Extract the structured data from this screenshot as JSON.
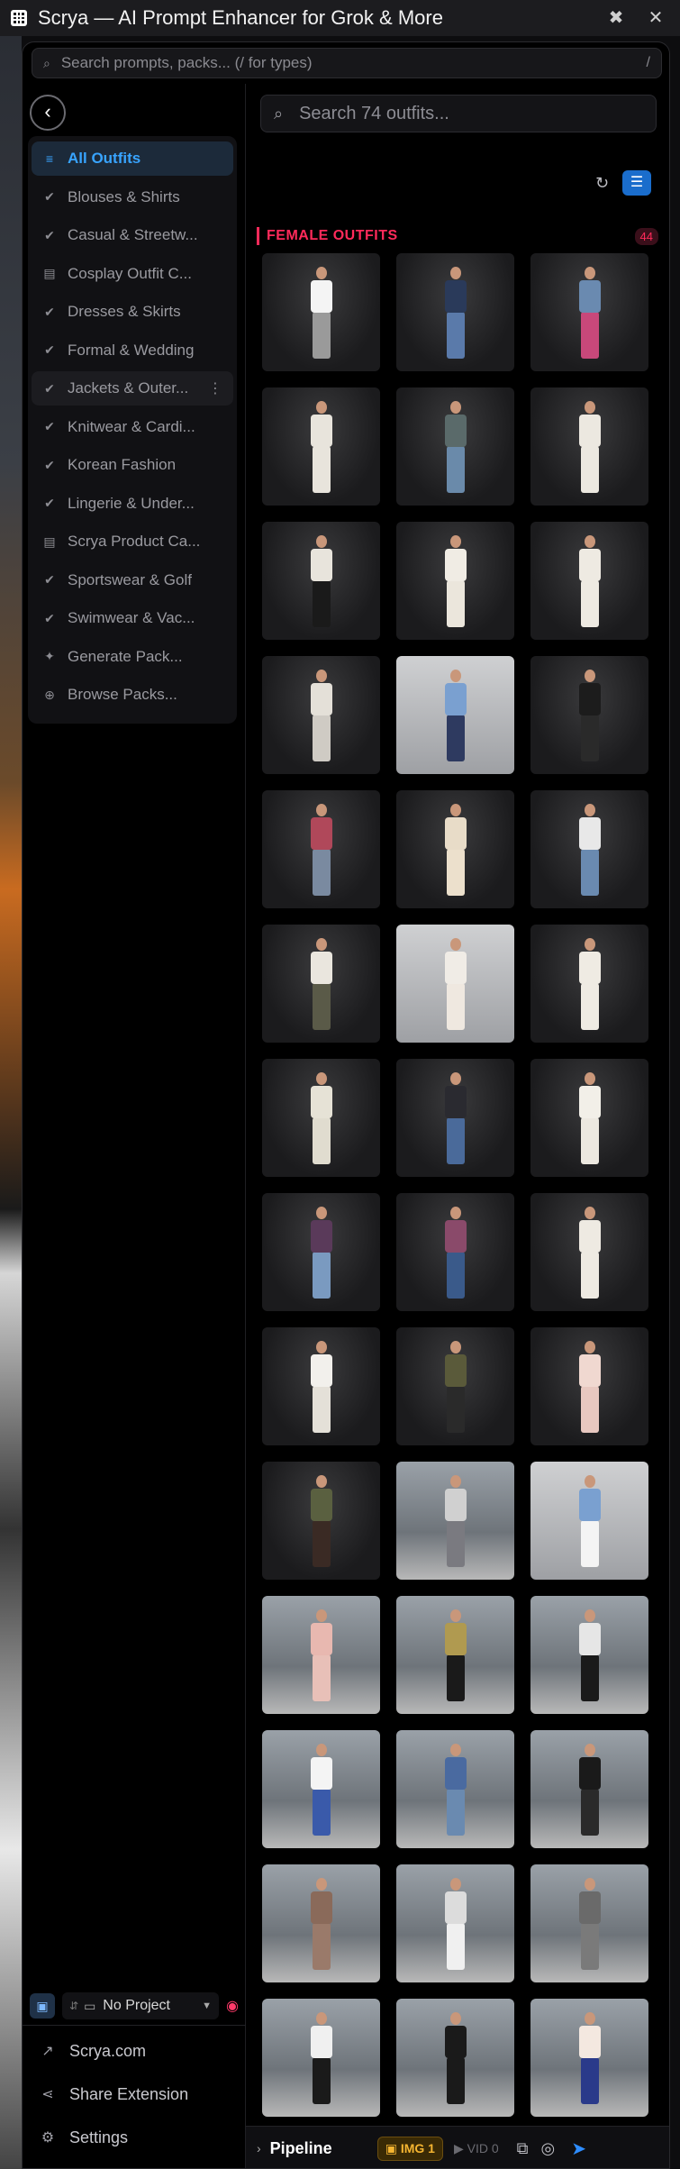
{
  "window": {
    "title": "Scrya — AI Prompt Enhancer for Grok & More"
  },
  "top_search": {
    "placeholder": "Search prompts, packs... (/ for types)",
    "shortcut": "/"
  },
  "sidebar": {
    "items": [
      {
        "label": "All Outfits",
        "icon": "list-icon",
        "active": true
      },
      {
        "label": "Blouses & Shirts",
        "icon": "check-icon"
      },
      {
        "label": "Casual & Streetw...",
        "icon": "check-icon"
      },
      {
        "label": "Cosplay Outfit C...",
        "icon": "box-icon"
      },
      {
        "label": "Dresses & Skirts",
        "icon": "check-icon"
      },
      {
        "label": "Formal & Wedding",
        "icon": "check-icon"
      },
      {
        "label": "Jackets & Outer...",
        "icon": "check-icon",
        "hover": true
      },
      {
        "label": "Knitwear & Cardi...",
        "icon": "check-icon"
      },
      {
        "label": "Korean Fashion",
        "icon": "check-icon"
      },
      {
        "label": "Lingerie & Under...",
        "icon": "check-icon"
      },
      {
        "label": "Scrya Product Ca...",
        "icon": "box-icon"
      },
      {
        "label": "Sportswear & Golf",
        "icon": "check-icon"
      },
      {
        "label": "Swimwear & Vac...",
        "icon": "check-icon"
      },
      {
        "label": "Generate Pack...",
        "icon": "sparkle-icon"
      },
      {
        "label": "Browse Packs...",
        "icon": "plus-circle-icon"
      }
    ],
    "project": {
      "label": "No Project"
    },
    "links": [
      {
        "label": "Scrya.com",
        "icon": "external-link-icon"
      },
      {
        "label": "Share Extension",
        "icon": "share-icon"
      },
      {
        "label": "Settings",
        "icon": "gear-icon"
      }
    ]
  },
  "main": {
    "search_placeholder": "Search 74 outfits...",
    "section": {
      "title": "FEMALE OUTFITS",
      "count": "44"
    },
    "tiles": [
      {
        "style": "dark",
        "top": "#f4f4f4",
        "bottom": "#9a9a9a"
      },
      {
        "style": "dark",
        "top": "#2a3a5a",
        "bottom": "#5a7aaa"
      },
      {
        "style": "dark",
        "top": "#6a8ab0",
        "bottom": "#c8487a"
      },
      {
        "style": "dark",
        "top": "#e8e4dc",
        "bottom": "#e8e4dc"
      },
      {
        "style": "dark",
        "top": "#5a6a6a",
        "bottom": "#6a8aaa"
      },
      {
        "style": "dark",
        "top": "#ece8e0",
        "bottom": "#ece8e0"
      },
      {
        "style": "dark",
        "top": "#e8e4dc",
        "bottom": "#1a1a1a"
      },
      {
        "style": "dark",
        "top": "#f0ece4",
        "bottom": "#ebe6dc"
      },
      {
        "style": "dark",
        "top": "#eeeae2",
        "bottom": "#eeeae2"
      },
      {
        "style": "dark",
        "top": "#e4e0d8",
        "bottom": "#cfcbc4"
      },
      {
        "style": "light",
        "top": "#7aa0d0",
        "bottom": "#2e3a60"
      },
      {
        "style": "dark",
        "top": "#1c1c1c",
        "bottom": "#2a2a2a"
      },
      {
        "style": "dark",
        "top": "#b0485a",
        "bottom": "#7a8aa0"
      },
      {
        "style": "dark",
        "top": "#e8dcc8",
        "bottom": "#ece0cc"
      },
      {
        "style": "dark",
        "top": "#e8e8e8",
        "bottom": "#6a8ab0"
      },
      {
        "style": "dark",
        "top": "#eae6de",
        "bottom": "#5a5a48"
      },
      {
        "style": "light",
        "top": "#f0ece6",
        "bottom": "#efe8e0"
      },
      {
        "style": "dark",
        "top": "#efebe3",
        "bottom": "#efebe3"
      },
      {
        "style": "dark",
        "top": "#e6e2d6",
        "bottom": "#e0dccf"
      },
      {
        "style": "dark",
        "top": "#2a2a30",
        "bottom": "#4a6a9a"
      },
      {
        "style": "dark",
        "top": "#f2efe8",
        "bottom": "#ece8e0"
      },
      {
        "style": "dark",
        "top": "#5a3a5a",
        "bottom": "#7a9ac0"
      },
      {
        "style": "dark",
        "top": "#8a4a6a",
        "bottom": "#3a5a8a"
      },
      {
        "style": "dark",
        "top": "#eeeae2",
        "bottom": "#eeeae2"
      },
      {
        "style": "dark",
        "top": "#f2f0ec",
        "bottom": "#e4e0d8"
      },
      {
        "style": "dark",
        "top": "#5a5a3a",
        "bottom": "#2a2a2a"
      },
      {
        "style": "dark",
        "top": "#f0d8d0",
        "bottom": "#e8c8c0"
      },
      {
        "style": "dark",
        "top": "#5a6040",
        "bottom": "#3a2a24"
      },
      {
        "style": "street",
        "top": "#d0d0d0",
        "bottom": "#7a7a80"
      },
      {
        "style": "light",
        "top": "#7aa0d0",
        "bottom": "#f4f4f4"
      },
      {
        "style": "street",
        "top": "#e8b8b0",
        "bottom": "#e8c0b8"
      },
      {
        "style": "street",
        "top": "#b09a50",
        "bottom": "#1a1a1a"
      },
      {
        "style": "street",
        "top": "#e6e6e6",
        "bottom": "#1a1a1a"
      },
      {
        "style": "street",
        "top": "#f4f4f4",
        "bottom": "#3a5aaa"
      },
      {
        "style": "street",
        "top": "#4a6aa0",
        "bottom": "#6a8ab0"
      },
      {
        "style": "street",
        "top": "#1a1a1a",
        "bottom": "#2a2a2a"
      },
      {
        "style": "street",
        "top": "#8a6a5a",
        "bottom": "#9a7a6a"
      },
      {
        "style": "street",
        "top": "#dcdcdc",
        "bottom": "#f0f0f0"
      },
      {
        "style": "street",
        "top": "#6a6a6a",
        "bottom": "#7a7a7a"
      },
      {
        "style": "street",
        "top": "#f0f0f0",
        "bottom": "#1a1a1a"
      },
      {
        "style": "street",
        "top": "#1a1a1a",
        "bottom": "#1a1a1a"
      },
      {
        "style": "street",
        "top": "#f4e8e0",
        "bottom": "#2a3a8a"
      }
    ]
  },
  "pipeline": {
    "label": "Pipeline",
    "img_badge": "IMG 1",
    "vid_badge": "VID 0"
  },
  "colors": {
    "accent_blue": "#38a4ff",
    "accent_pink": "#ff2a5a",
    "img_badge": "#f5b531"
  }
}
